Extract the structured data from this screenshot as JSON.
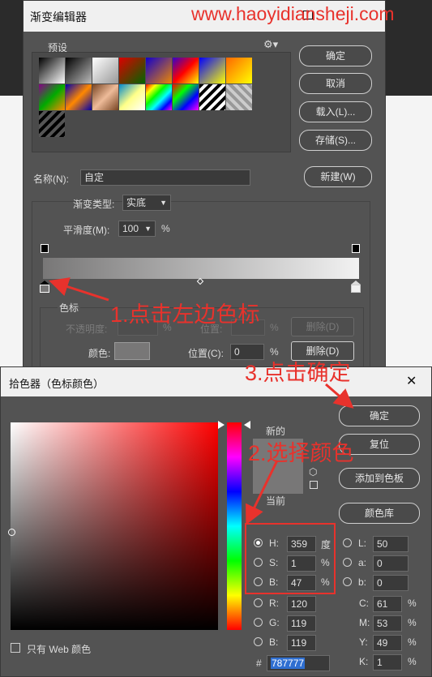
{
  "watermark": "www.haoyidiansheji.com",
  "gradient_editor": {
    "title": "渐变编辑器",
    "presets_label": "预设",
    "buttons": {
      "ok": "确定",
      "cancel": "取消",
      "load": "载入(L)...",
      "save": "存储(S)...",
      "new": "新建(W)"
    },
    "name_label": "名称(N):",
    "name_value": "自定",
    "type_label": "渐变类型:",
    "type_value": "实底",
    "smoothness_label": "平滑度(M):",
    "smoothness_value": "100",
    "percent": "%",
    "stops_label": "色标",
    "opacity_label": "不透明度:",
    "location_label": "位置:",
    "delete_label": "删除(D)",
    "color_label": "颜色:",
    "location_c_label": "位置(C):",
    "location_c_value": "0",
    "delete_button": "删除(D)",
    "swatch_color": "#787777"
  },
  "color_picker": {
    "title": "拾色器（色标颜色）",
    "new_label": "新的",
    "current_label": "当前",
    "buttons": {
      "ok": "确定",
      "reset": "复位",
      "add_swatch": "添加到色板",
      "library": "颜色库"
    },
    "hsb": [
      {
        "label": "H:",
        "value": "359",
        "unit": "度",
        "selected": true
      },
      {
        "label": "S:",
        "value": "1",
        "unit": "%",
        "selected": false
      },
      {
        "label": "B:",
        "value": "47",
        "unit": "%",
        "selected": false
      }
    ],
    "rgb": [
      {
        "label": "R:",
        "value": "120"
      },
      {
        "label": "G:",
        "value": "119"
      },
      {
        "label": "B:",
        "value": "119"
      }
    ],
    "lab": [
      {
        "label": "L:",
        "value": "50"
      },
      {
        "label": "a:",
        "value": "0"
      },
      {
        "label": "b:",
        "value": "0"
      }
    ],
    "cmyk": [
      {
        "label": "C:",
        "value": "61",
        "unit": "%"
      },
      {
        "label": "M:",
        "value": "53",
        "unit": "%"
      },
      {
        "label": "Y:",
        "value": "49",
        "unit": "%"
      },
      {
        "label": "K:",
        "value": "1",
        "unit": "%"
      }
    ],
    "hex_label": "#",
    "hex_value": "787777",
    "web_only_label": "只有 Web 颜色",
    "new_color": "#787777",
    "current_color": "#787777"
  },
  "annotations": {
    "step1": "1.点击左边色标",
    "step2": "2.选择颜色",
    "step3": "3.点击确定"
  }
}
